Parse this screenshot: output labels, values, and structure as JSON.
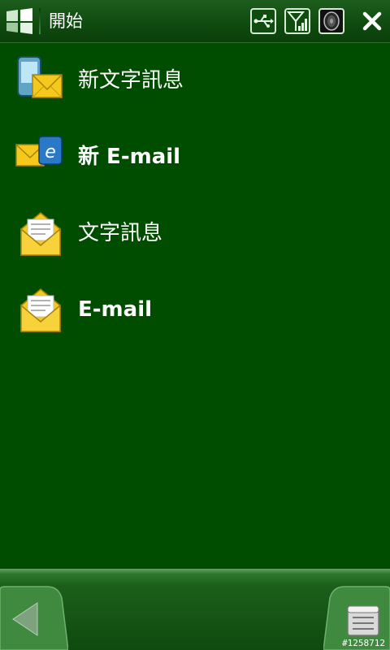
{
  "titlebar": {
    "title": "開始",
    "icons": [
      "windows-start-logo",
      "usb-icon",
      "signal-icon",
      "volume-icon",
      "close-icon"
    ]
  },
  "list": {
    "items": [
      {
        "label": "新文字訊息",
        "icon": "new-sms-icon",
        "bold": false
      },
      {
        "label": "新 E-mail",
        "icon": "new-email-icon",
        "bold": true
      },
      {
        "label": "文字訊息",
        "icon": "sms-envelope-icon",
        "bold": false
      },
      {
        "label": "E-mail",
        "icon": "email-envelope-icon",
        "bold": true
      }
    ]
  },
  "bottombar": {
    "left_icon": "back-arrow-icon",
    "right_icon": "menu-icon"
  },
  "watermark": "#1258712",
  "colors": {
    "background": "#004d00",
    "titlebar": "#0f4a0f",
    "envelope": "#f4c91c"
  }
}
